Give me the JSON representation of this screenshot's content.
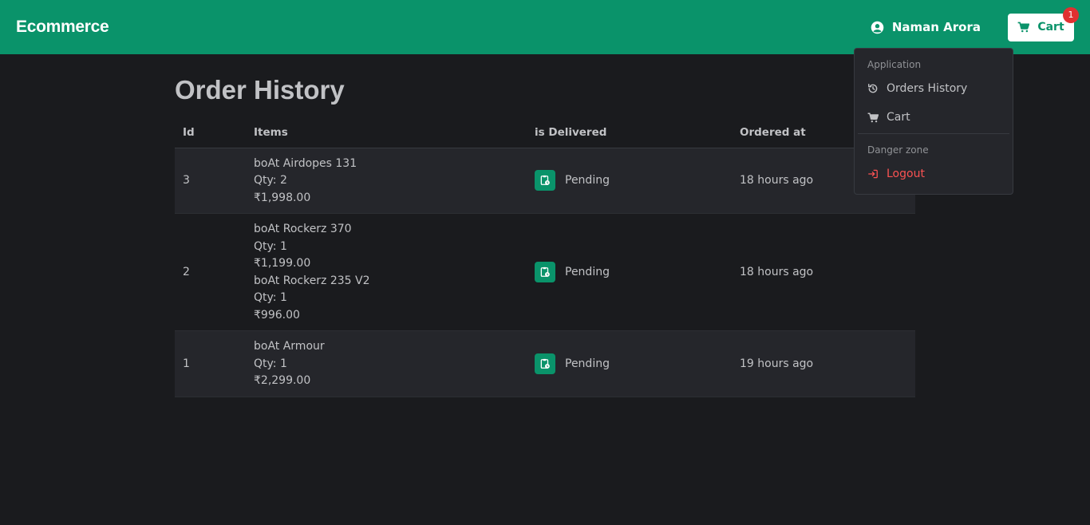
{
  "header": {
    "brand": "Ecommerce",
    "user_name": "Naman Arora",
    "cart_label": "Cart",
    "cart_count": "1"
  },
  "page": {
    "title": "Order History"
  },
  "table": {
    "columns": [
      "Id",
      "Items",
      "is Delivered",
      "Ordered at"
    ],
    "rows": [
      {
        "id": "3",
        "items": [
          {
            "name": "boAt Airdopes 131",
            "qty": "Qty: 2",
            "price": "₹1,998.00"
          }
        ],
        "status": "Pending",
        "ordered_at": "18 hours ago"
      },
      {
        "id": "2",
        "items": [
          {
            "name": "boAt Rockerz 370",
            "qty": "Qty: 1",
            "price": "₹1,199.00"
          },
          {
            "name": "boAt Rockerz 235 V2",
            "qty": "Qty: 1",
            "price": "₹996.00"
          }
        ],
        "status": "Pending",
        "ordered_at": "18 hours ago"
      },
      {
        "id": "1",
        "items": [
          {
            "name": "boAt Armour",
            "qty": "Qty: 1",
            "price": "₹2,299.00"
          }
        ],
        "status": "Pending",
        "ordered_at": "19 hours ago"
      }
    ]
  },
  "dropdown": {
    "application_label": "Application",
    "orders_history": "Orders History",
    "cart": "Cart",
    "danger_label": "Danger zone",
    "logout": "Logout"
  },
  "colors": {
    "accent": "#0a936a",
    "background": "#1a1b1e",
    "danger": "#fa5252",
    "badge": "#e03131"
  }
}
